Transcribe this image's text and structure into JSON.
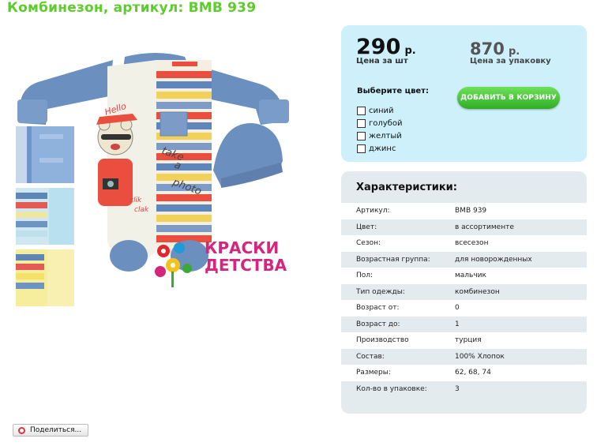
{
  "title": "Комбинезон, артикул: BMB 939",
  "brand": {
    "line1": "КРАСКИ",
    "line2": "ДЕТСТВА"
  },
  "price": {
    "unit_value": "290",
    "unit_currency": "р.",
    "unit_label": "Цена за шт",
    "pack_value": "870",
    "pack_currency": "р.",
    "pack_label": "Цена за упаковку"
  },
  "colors": {
    "title": "Выберите цвет:",
    "options": [
      "синий",
      "голубой",
      "желтый",
      "джинс"
    ]
  },
  "cart_button": "ДОБАВИТЬ В КОРЗИНУ",
  "characteristics": {
    "title": "Характеристики:",
    "rows": [
      {
        "k": "Артикул:",
        "v": "BMB 939"
      },
      {
        "k": "Цвет:",
        "v": "в ассортименте"
      },
      {
        "k": "Сезон:",
        "v": "всесезон"
      },
      {
        "k": "Возрастная группа:",
        "v": "для новорожденных"
      },
      {
        "k": "Пол:",
        "v": "мальчик"
      },
      {
        "k": "Тип одежды:",
        "v": "комбинезон"
      },
      {
        "k": "Возраст от:",
        "v": "0"
      },
      {
        "k": "Возраст до:",
        "v": "1"
      },
      {
        "k": "Производство",
        "v": "турция"
      },
      {
        "k": "Состав:",
        "v": "100% Хлопок"
      },
      {
        "k": "Размеры:",
        "v": "62, 68, 74"
      },
      {
        "k": "Кол-во в упаковке:",
        "v": "3"
      }
    ]
  },
  "share_label": "Поделиться...",
  "print_text": {
    "hello": "Hello",
    "take": "take",
    "a": "a",
    "photo": "photo",
    "clik": "clik",
    "clak": "clak"
  }
}
